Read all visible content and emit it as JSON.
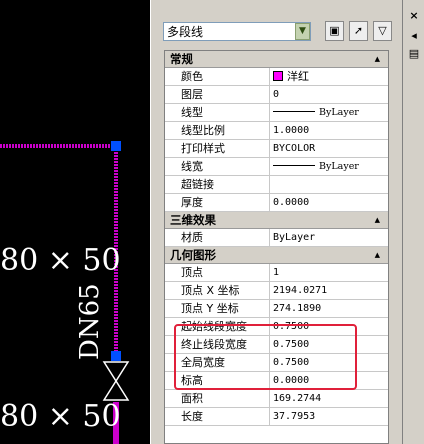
{
  "cad": {
    "dim_top": "80 × 50",
    "dim_bottom": "80 × 50",
    "pipe_label": "DN65",
    "line_color": "#cc00cc",
    "grip_color": "#0050ff"
  },
  "gutter": {
    "close": "×",
    "pin": "◂",
    "menu": "▤"
  },
  "palette": {
    "object_type": "多段线",
    "tool_icons": [
      "select-objects-icon",
      "toggle-pickadd-icon",
      "quick-select-icon"
    ]
  },
  "sections": [
    {
      "title": "常规",
      "rows": [
        {
          "label": "颜色",
          "value": "洋红",
          "kind": "color",
          "color": "#ff00ff"
        },
        {
          "label": "图层",
          "value": "0"
        },
        {
          "label": "线型",
          "value": "ByLayer",
          "kind": "linetype"
        },
        {
          "label": "线型比例",
          "value": "1.0000"
        },
        {
          "label": "打印样式",
          "value": "BYCOLOR"
        },
        {
          "label": "线宽",
          "value": "ByLayer",
          "kind": "linetype"
        },
        {
          "label": "超链接",
          "value": ""
        },
        {
          "label": "厚度",
          "value": "0.0000"
        }
      ]
    },
    {
      "title": "三维效果",
      "rows": [
        {
          "label": "材质",
          "value": "ByLayer"
        }
      ]
    },
    {
      "title": "几何图形",
      "rows": [
        {
          "label": "顶点",
          "value": "1"
        },
        {
          "label": "顶点 X 坐标",
          "value": "2194.0271"
        },
        {
          "label": "顶点 Y 坐标",
          "value": "274.1890"
        },
        {
          "label": "起始线段宽度",
          "value": "0.7500"
        },
        {
          "label": "终止线段宽度",
          "value": "0.7500"
        },
        {
          "label": "全局宽度",
          "value": "0.7500"
        },
        {
          "label": "标高",
          "value": "0.0000"
        },
        {
          "label": "面积",
          "value": "169.2744"
        },
        {
          "label": "长度",
          "value": "37.7953"
        }
      ]
    }
  ],
  "highlight_color": "#e0203a"
}
